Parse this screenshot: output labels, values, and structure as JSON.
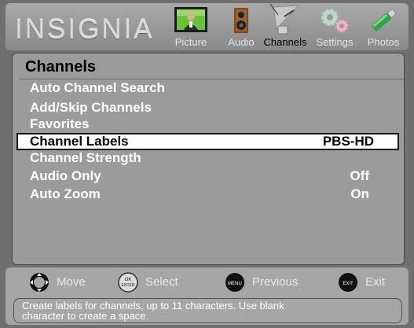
{
  "brand": {
    "logo": "INSIGNIA"
  },
  "tabs": [
    {
      "label": "Picture",
      "icon": "tv-picture-icon",
      "active": false
    },
    {
      "label": "Audio",
      "icon": "speaker-icon",
      "active": false
    },
    {
      "label": "Channels",
      "icon": "satellite-dish-icon",
      "active": true
    },
    {
      "label": "Settings",
      "icon": "gears-icon",
      "active": false
    },
    {
      "label": "Photos",
      "icon": "usb-stick-icon",
      "active": false
    }
  ],
  "panel": {
    "title": "Channels",
    "items": [
      {
        "label": "Auto Channel Search",
        "value": ""
      },
      {
        "label": "Add/Skip Channels",
        "value": ""
      },
      {
        "label": "Favorites",
        "value": ""
      },
      {
        "label": "Channel Labels",
        "value": "PBS-HD",
        "selected": true
      },
      {
        "label": "Channel Strength",
        "value": ""
      },
      {
        "label": "Audio Only",
        "value": "Off"
      },
      {
        "label": "Auto Zoom",
        "value": "On"
      }
    ]
  },
  "help": {
    "hints": [
      {
        "button": "dpad-icon",
        "label": "Move"
      },
      {
        "button": "ok-enter-button-icon",
        "button_text_top": "OK",
        "button_text_bottom": "ENTER",
        "label": "Select"
      },
      {
        "button": "menu-button-icon",
        "button_text": "MENU",
        "label": "Previous"
      },
      {
        "button": "exit-button-icon",
        "button_text": "EXIT",
        "label": "Exit"
      }
    ],
    "status_line1": "Create labels for channels, up to 11 characters. Use blank",
    "status_line2": "character to create a space"
  },
  "colors": {
    "panel": "#9b9b9b",
    "selected_bg": "#ffffff",
    "topbar": "#9a9a9a",
    "text": "#ffffff"
  }
}
